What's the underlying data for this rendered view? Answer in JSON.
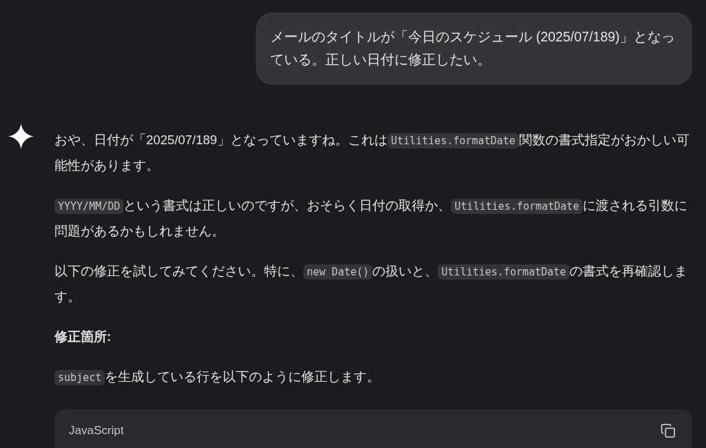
{
  "user_message": {
    "text": "メールのタイトルが「今日のスケジュール (2025/07/189)」となっている。正しい日付に修正したい。"
  },
  "response": {
    "paragraphs": [
      {
        "kind": "text",
        "segments": [
          {
            "kind": "text",
            "text": "おや、日付が「2025/07/189」となっていますね。これは"
          },
          {
            "kind": "code",
            "text": "Utilities.formatDate"
          },
          {
            "kind": "text",
            "text": "関数の書式指定がおかしい可能性があります。"
          }
        ]
      },
      {
        "kind": "text",
        "segments": [
          {
            "kind": "code",
            "text": "YYYY/MM/DD"
          },
          {
            "kind": "text",
            "text": "という書式は正しいのですが、おそらく日付の取得か、"
          },
          {
            "kind": "code",
            "text": "Utilities.formatDate"
          },
          {
            "kind": "text",
            "text": "に渡される引数に問題があるかもしれません。"
          }
        ]
      },
      {
        "kind": "text",
        "segments": [
          {
            "kind": "text",
            "text": "以下の修正を試してみてください。特に、"
          },
          {
            "kind": "code",
            "text": "new Date()"
          },
          {
            "kind": "text",
            "text": "の扱いと、"
          },
          {
            "kind": "code",
            "text": "Utilities.formatDate"
          },
          {
            "kind": "text",
            "text": "の書式を再確認します。"
          }
        ]
      },
      {
        "kind": "heading",
        "segments": [
          {
            "kind": "text",
            "text": "修正箇所:"
          }
        ]
      },
      {
        "kind": "text",
        "segments": [
          {
            "kind": "code",
            "text": "subject"
          },
          {
            "kind": "text",
            "text": "を生成している行を以下のように修正します。"
          }
        ]
      }
    ],
    "code_block": {
      "language": "JavaScript"
    }
  }
}
